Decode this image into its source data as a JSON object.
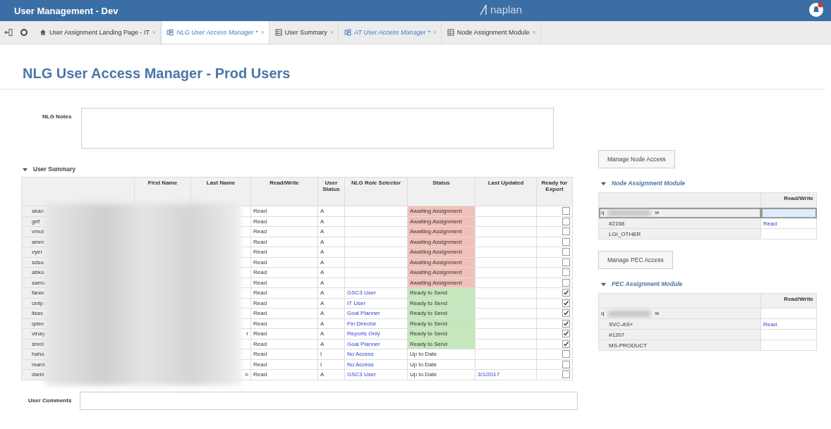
{
  "window": {
    "title": "User Management - Dev",
    "logo": "naplan"
  },
  "tabs": [
    {
      "kind": "home",
      "label": "User Assignment Landing Page - IT",
      "selected": false
    },
    {
      "kind": "dashboard",
      "label": "NLG User Access Manager *",
      "selected": true
    },
    {
      "kind": "module",
      "label": "User Summary",
      "selected": false
    },
    {
      "kind": "dashboard",
      "label": "AT User Access Manager *",
      "selected": false
    },
    {
      "kind": "module",
      "label": "Node Assignment Module",
      "selected": false
    }
  ],
  "tab_close": "×",
  "page_title": "NLG User Access Manager - Prod Users",
  "notes": {
    "label": "NLG Notes"
  },
  "user_summary": {
    "title": "User Summary",
    "expanded": true,
    "columns": [
      "First Name",
      "Last Name",
      "Read/Write",
      "User Status",
      "NLG Role Selector",
      "Status",
      "Last Updated",
      "Ready for Export"
    ],
    "rows": [
      {
        "user": "skan",
        "access": "Read",
        "user_status": "A",
        "status": "Awaiting Assignment",
        "color": "#f2c0b8",
        "checked": false
      },
      {
        "user": "grif",
        "access": "Read",
        "user_status": "A",
        "status": "Awaiting Assignment",
        "color": "#f2c0b8",
        "checked": false
      },
      {
        "user": "vmut",
        "access": "Read",
        "user_status": "A",
        "status": "Awaiting Assignment",
        "color": "#f2c0b8",
        "checked": false
      },
      {
        "user": "amm",
        "access": "Read",
        "user_status": "A",
        "status": "Awaiting Assignment",
        "color": "#f2c0b8",
        "checked": false
      },
      {
        "user": "vyer",
        "access": "Read",
        "user_status": "A",
        "status": "Awaiting Assignment",
        "color": "#f2c0b8",
        "checked": false
      },
      {
        "user": "sdsa",
        "access": "Read",
        "user_status": "A",
        "status": "Awaiting Assignment",
        "color": "#f2c0b8",
        "checked": false
      },
      {
        "user": "abka",
        "access": "Read",
        "user_status": "A",
        "status": "Awaiting Assignment",
        "color": "#f2c0b8",
        "checked": false
      },
      {
        "user": "samu",
        "access": "Read",
        "user_status": "A",
        "status": "Awaiting Assignment",
        "color": "#f2c0b8",
        "checked": false
      },
      {
        "user": "fanar",
        "access": "Read",
        "user_status": "A",
        "role": "GSC3 User",
        "status": "Ready to Send",
        "color": "#c4e8bc",
        "checked": true
      },
      {
        "user": "celip",
        "access": "Read",
        "user_status": "A",
        "role": "IT User",
        "status": "Ready to Send",
        "color": "#c4e8bc",
        "checked": true
      },
      {
        "user": "lisas",
        "access": "Read",
        "user_status": "A",
        "role": "Goal Planner",
        "status": "Ready to Send",
        "color": "#c4e8bc",
        "checked": true
      },
      {
        "user": "qdee",
        "access": "Read",
        "user_status": "A",
        "role": "Fin Director",
        "status": "Ready to Send",
        "color": "#c4e8bc",
        "checked": true
      },
      {
        "user": "vinay",
        "last_name": "r",
        "access": "Read",
        "user_status": "A",
        "role": "Reports Only",
        "status": "Ready to Send",
        "color": "#c4e8bc",
        "checked": true
      },
      {
        "user": "shrdi",
        "access": "Read",
        "user_status": "A",
        "role": "Goal Planner",
        "status": "Ready to Send",
        "color": "#c4e8bc",
        "checked": true
      },
      {
        "user": "haha",
        "access": "Read",
        "user_status": "I",
        "role": "No Access",
        "status": "Up to Date",
        "color": "#ffffff",
        "checked": false
      },
      {
        "user": "mank",
        "access": "Read",
        "user_status": "I",
        "role": "No Access",
        "status": "Up to Date",
        "color": "#ffffff",
        "checked": false
      },
      {
        "user": "darid",
        "last_name": "n",
        "access": "Read",
        "user_status": "A",
        "role": "GSC3 User",
        "status": "Up to Date",
        "color": "#ffffff",
        "last_updated": "3/1/2017",
        "checked": false
      }
    ]
  },
  "comments": {
    "label": "User Comments"
  },
  "node_button": "Manage Node Access",
  "node_module": {
    "title": "Node Assignment Module",
    "expanded": true,
    "column": "Read/Write",
    "items": [
      {
        "label": "q",
        "label_end": "w",
        "selected": true,
        "children": [
          {
            "label": "#2158",
            "value": "Read",
            "selected": false
          },
          {
            "label": "LGI_OTHER",
            "selected": false
          }
        ]
      }
    ]
  },
  "pec_button": "Manage PEC Access",
  "pec_module": {
    "title": "PEC Assignment Module",
    "expanded": true,
    "column": "Read/Write",
    "items": [
      {
        "label": "q",
        "label_end": "w",
        "selected": false,
        "children": [
          {
            "label": "SVC-AS+",
            "value": "Read",
            "selected": false
          },
          {
            "label": "#1207",
            "selected": false
          },
          {
            "label": "MS-PRODUCT",
            "selected": false
          }
        ]
      }
    ]
  }
}
